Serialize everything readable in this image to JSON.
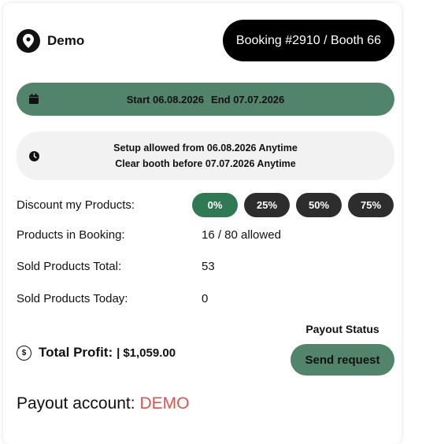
{
  "header": {
    "location_icon": "map-pin-icon",
    "location_name": "Demo",
    "booking_label": "Booking #2910 / Booth 66"
  },
  "dates": {
    "icon": "calendar-icon",
    "start": "Start 06.08.2026",
    "end": "End 07.07.2026"
  },
  "setup": {
    "icon": "clock-icon",
    "setup_text": "Setup allowed from 06.08.2026 Anytime",
    "clear_text": "Clear booth before 07.07.2026 Anytime"
  },
  "discount": {
    "label": "Discount my Products:",
    "options": [
      "0%",
      "25%",
      "50%",
      "75%"
    ],
    "selected": "0%"
  },
  "stats": {
    "products_label": "Products in Booking:",
    "products_value": "16 / 80 allowed",
    "sold_total_label": "Sold Products Total:",
    "sold_total_value": "53",
    "sold_today_label": "Sold Products Today:",
    "sold_today_value": "0"
  },
  "profit": {
    "icon": "dollar-circle-icon",
    "label": "Total Profit:",
    "separator": "|",
    "value": "$1,059.00"
  },
  "payout": {
    "status_label": "Payout Status",
    "send_label": "Send request",
    "account_label": "Payout account:",
    "account_value": "DEMO"
  },
  "colors": {
    "accent_green": "#52836b",
    "selected_discount": "#2f7a55",
    "dark_button": "#2d2d2d",
    "account_red": "#d9534f"
  }
}
